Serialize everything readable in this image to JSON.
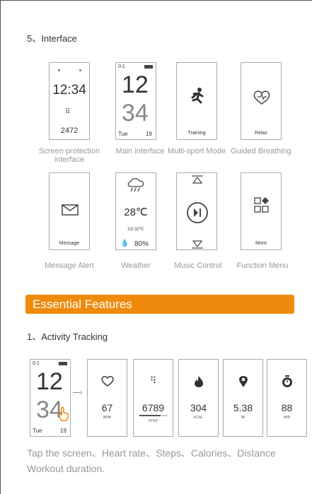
{
  "section5": {
    "heading": "5、Interface"
  },
  "row1": [
    {
      "caption": "Screen protection interface",
      "time": "12:34",
      "steps": "2472"
    },
    {
      "caption": "Main interface",
      "status": "0:1",
      "hour": "12",
      "minute": "34",
      "day": "Tue",
      "date": "19"
    },
    {
      "caption": "Multi-sport Mode",
      "label": "Training"
    },
    {
      "caption": "Guided Breathing",
      "label": "Relax"
    }
  ],
  "row2": [
    {
      "caption": "Message Alert",
      "label": "Message"
    },
    {
      "caption": "Weather",
      "temp": "28℃",
      "range": "22/ 32℃",
      "humidity": "80%"
    },
    {
      "caption": "Music Control"
    },
    {
      "caption": "Function Menu",
      "label": "More"
    }
  ],
  "banner": {
    "title": "Essential Features"
  },
  "section1": {
    "heading": "1、Activity Tracking"
  },
  "tracking": {
    "watch": {
      "status": "0:1",
      "hour": "12",
      "minute": "34",
      "day": "Tue",
      "date": "19"
    },
    "cards": [
      {
        "value": "67",
        "unit": "BPM",
        "icon": "heart-icon"
      },
      {
        "value": "6789",
        "unit": "STEP",
        "icon": "footprints-icon"
      },
      {
        "value": "304",
        "unit": "KCAL",
        "icon": "flame-icon"
      },
      {
        "value": "5.38",
        "unit": "MI",
        "icon": "location-pin-icon"
      },
      {
        "value": "88",
        "unit": "MIN",
        "icon": "stopwatch-icon"
      }
    ]
  },
  "footer": {
    "text": "Tap the screen、Heart rate、Steps、Calories、Distance Workout duration."
  }
}
